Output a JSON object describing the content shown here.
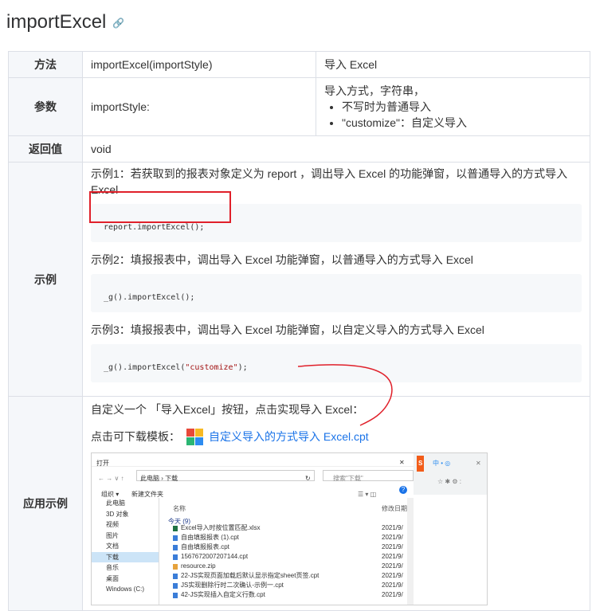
{
  "title": "importExcel",
  "link_icon": "link-icon",
  "table": {
    "method_label": "方法",
    "method_value": "importExcel(importStyle)",
    "method_desc": "导入 Excel",
    "param_label": "参数",
    "param_value": "importStyle:",
    "param_desc": "导入方式，字符串，",
    "param_opts": [
      "不写时为普通导入",
      "\"customize\"：自定义导入"
    ],
    "return_label": "返回值",
    "return_value": "void",
    "example_label": "示例",
    "ex1_text": "示例1：若获取到的报表对象定义为 report ，调出导入 Excel 的功能弹窗，以普通导入的方式导入 Excel",
    "ex1_code": "report.importExcel();",
    "ex2_text": "示例2：填报报表中，调出导入 Excel 功能弹窗，以普通导入的方式导入 Excel",
    "ex2_code": "_g().importExcel();",
    "ex3_text": "示例3：填报报表中，调出导入 Excel 功能弹窗，以自定义导入的方式导入 Excel",
    "ex3_code_pre": "_g().importExcel(",
    "ex3_code_str": "\"customize\"",
    "ex3_code_post": ");",
    "app_label": "应用示例",
    "app_text": "自定义一个 「导入Excel」按钮，点击实现导入 Excel：",
    "dl_prefix": "点击可下载模板：",
    "dl_link": "自定义导入的方式导入 Excel.cpt"
  },
  "dialog": {
    "title": "打开",
    "breadcrumb": "此电脑 › 下载",
    "search_placeholder": "搜索\"下载\"",
    "organize": "组织 ▾",
    "new_folder": "新建文件夹",
    "col_name": "名称",
    "col_date": "修改日期",
    "group_today": "今天 (9)",
    "sidebar": [
      "此电脑",
      "3D 对象",
      "视频",
      "图片",
      "文档",
      "下载",
      "音乐",
      "桌面",
      "Windows (C:)"
    ],
    "files": [
      {
        "name": "Excel导入时按位置匹配.xlsx",
        "date": "2021/9/"
      },
      {
        "name": "自由填报报表 (1).cpt",
        "date": "2021/9/"
      },
      {
        "name": "自由填报报表.cpt",
        "date": "2021/9/"
      },
      {
        "name": "1567672007207144.cpt",
        "date": "2021/9/"
      },
      {
        "name": "resource.zip",
        "date": "2021/9/"
      },
      {
        "name": "22-JS实现页面加载后默认显示指定sheet页签.cpt",
        "date": "2021/9/"
      },
      {
        "name": "JS实现删除行时二次确认-示例一.cpt",
        "date": "2021/9/"
      },
      {
        "name": "42-JS实现插入自定义行数.cpt",
        "date": "2021/9/"
      }
    ]
  },
  "colors": {
    "accent": "#1a73e8",
    "annotation": "#e0202a"
  }
}
